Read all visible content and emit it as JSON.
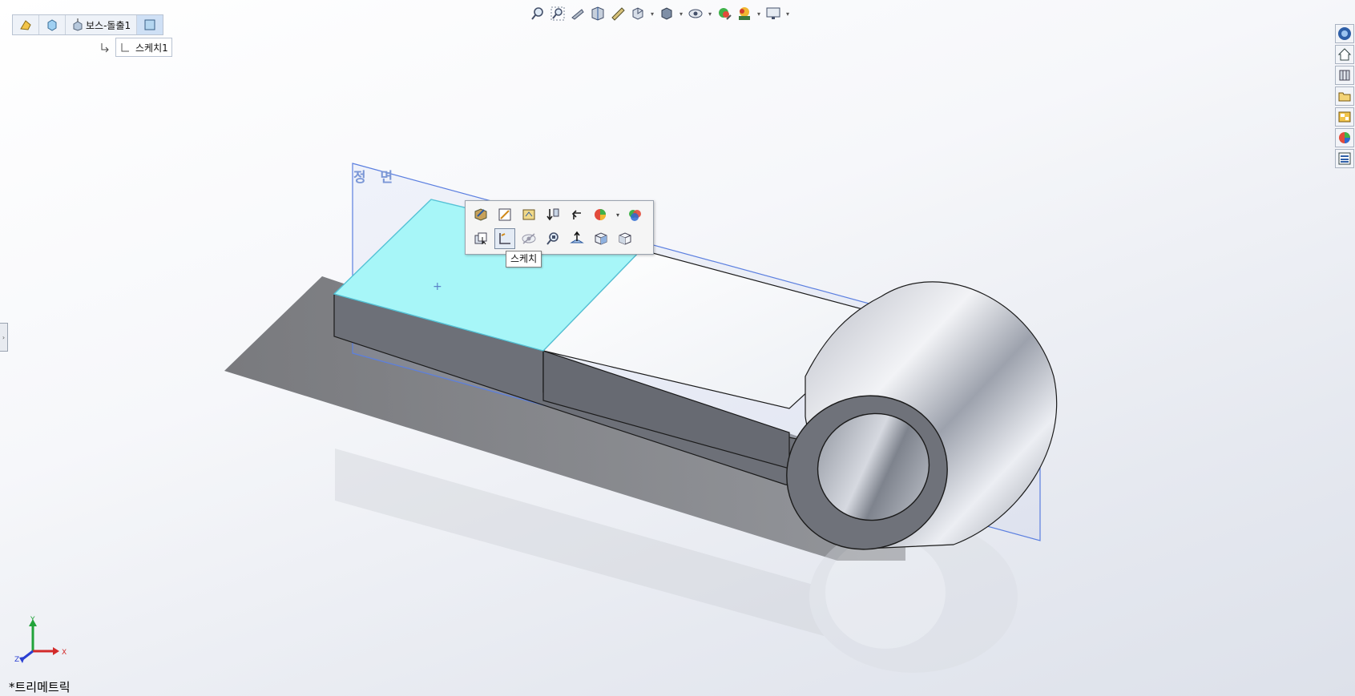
{
  "breadcrumb": {
    "items": [
      {
        "icon": "part-icon",
        "label": ""
      },
      {
        "icon": "solid-body-icon",
        "label": ""
      },
      {
        "icon": "boss-extrude-icon",
        "label": "보스-돌출1"
      },
      {
        "icon": "face-icon",
        "label": ""
      }
    ],
    "sub_item": {
      "icon": "sketch-icon",
      "label": "스케치1"
    }
  },
  "heads_up_toolbar": {
    "items": [
      "zoom-to-fit-icon",
      "zoom-to-area-icon",
      "previous-view-icon",
      "section-view-icon",
      "dynamic-annotation-icon",
      "view-orientation-icon",
      "display-style-icon",
      "hide-show-items-icon",
      "edit-appearance-icon",
      "apply-scene-icon",
      "view-settings-icon"
    ]
  },
  "context_toolbar": {
    "row1": [
      "edit-feature-icon",
      "edit-sketch-icon",
      "sketch-plane-icon",
      "rollback-icon",
      "parent-child-icon",
      "appearance-icon",
      "appearance-callout-icon"
    ],
    "row2": [
      "select-other-icon",
      "sketch-icon",
      "hide-icon",
      "zoom-to-selection-icon",
      "normal-to-icon",
      "isometric-icon",
      "plane-view-icon"
    ],
    "tooltip": "스케치"
  },
  "task_pane": {
    "items": [
      "solidworks-resources-icon",
      "home-icon",
      "design-library-icon",
      "file-explorer-icon",
      "view-palette-icon",
      "appearances-icon",
      "custom-properties-icon"
    ]
  },
  "plane_label": "정 면",
  "view_name": "*트리메트릭",
  "triad": {
    "x": "X",
    "y": "Y",
    "z": "Z"
  },
  "colors": {
    "selection": "#a7f6f8",
    "plane_outline": "#5b7fe0",
    "body_dark": "#6d7078",
    "body_top": "#ffffff"
  }
}
